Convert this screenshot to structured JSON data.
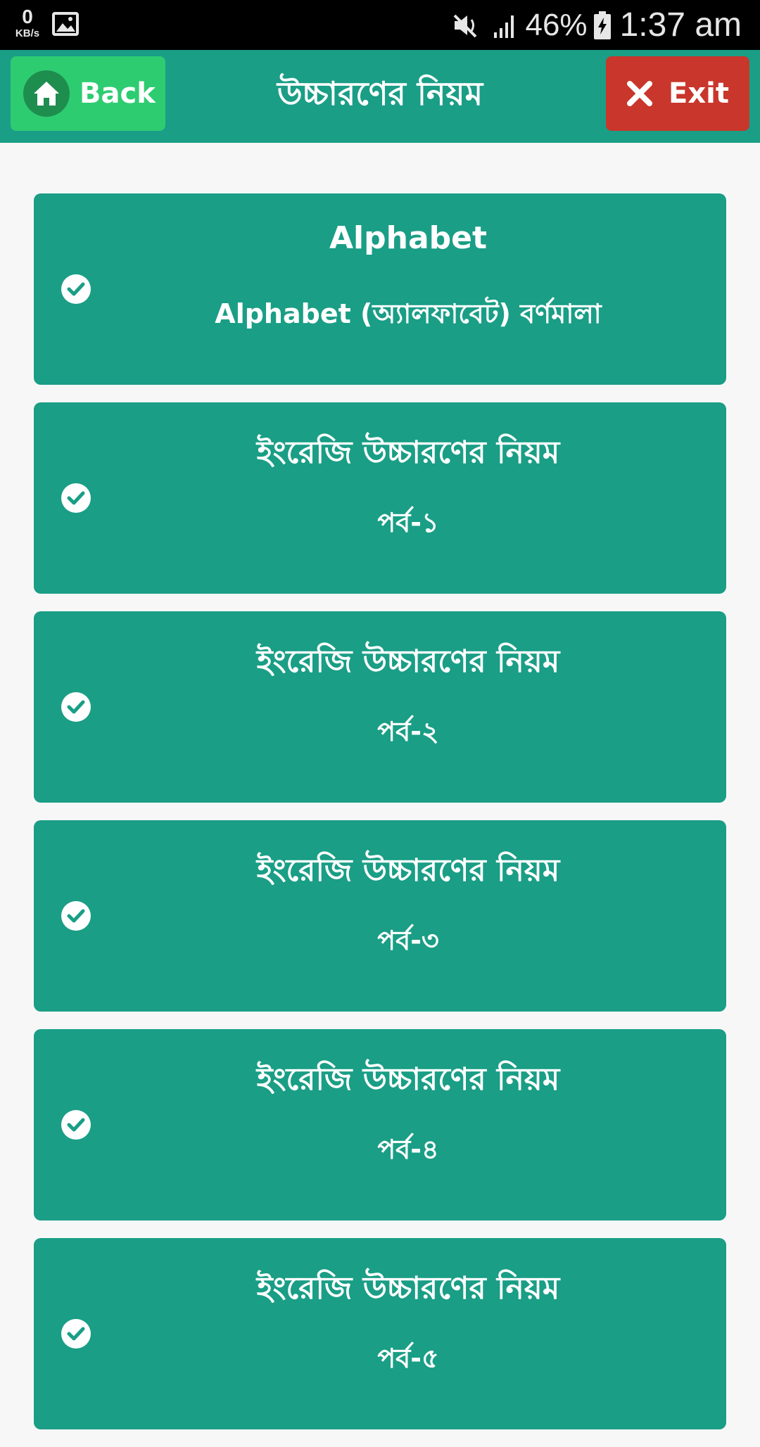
{
  "status_bar": {
    "speed_value": "0",
    "speed_unit": "KB/s",
    "battery_percent": "46%",
    "time": "1:37 am",
    "icons": [
      "gallery-icon",
      "mute-icon",
      "signal-icon",
      "battery-charging-icon"
    ]
  },
  "app_bar": {
    "back_label": "Back",
    "title": "উচ্চারণের নিয়ম",
    "exit_label": "Exit",
    "colors": {
      "bar": "#1a9e86",
      "back": "#2ecc71",
      "exit": "#c9362b"
    }
  },
  "lessons": [
    {
      "title": "Alphabet",
      "subtitle": "Alphabet (অ্যালফাবেট) বর্ণমালা"
    },
    {
      "title": "ইংরেজি উচ্চারণের নিয়ম",
      "subtitle": "পর্ব-১"
    },
    {
      "title": "ইংরেজি উচ্চারণের নিয়ম",
      "subtitle": "পর্ব-২"
    },
    {
      "title": "ইংরেজি উচ্চারণের নিয়ম",
      "subtitle": "পর্ব-৩"
    },
    {
      "title": "ইংরেজি উচ্চারণের নিয়ম",
      "subtitle": "পর্ব-৪"
    },
    {
      "title": "ইংরেজি উচ্চারণের নিয়ম",
      "subtitle": "পর্ব-৫"
    }
  ],
  "theme": {
    "card_color": "#1a9e86",
    "background": "#f7f7f7"
  }
}
